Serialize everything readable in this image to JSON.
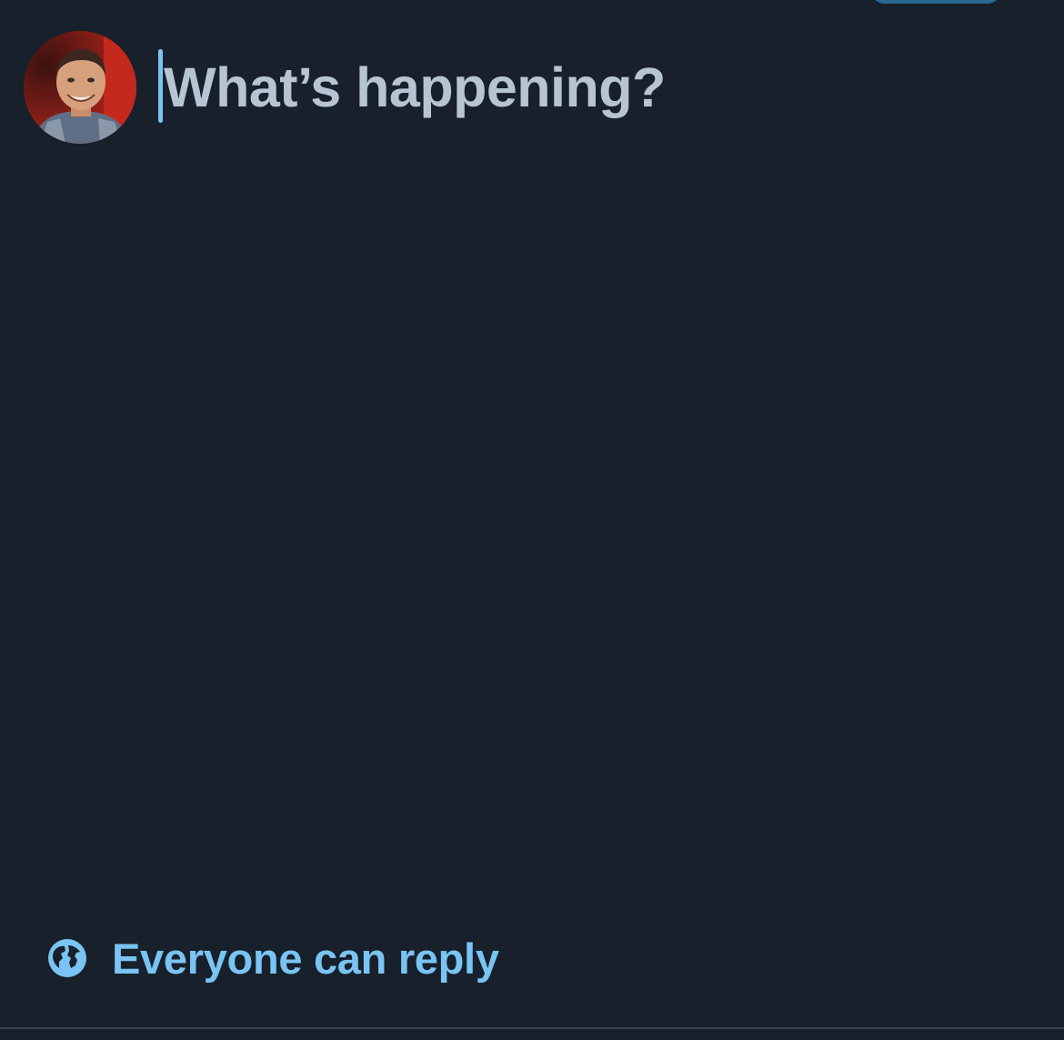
{
  "composer": {
    "placeholder": "What’s happening?"
  },
  "reply_setting": {
    "label": "Everyone can reply",
    "icon": "globe-icon"
  },
  "avatar": {
    "icon": "user-avatar"
  },
  "colors": {
    "background": "#17202b",
    "accent": "#79c4f2",
    "placeholder_text": "#b7c5d3"
  }
}
